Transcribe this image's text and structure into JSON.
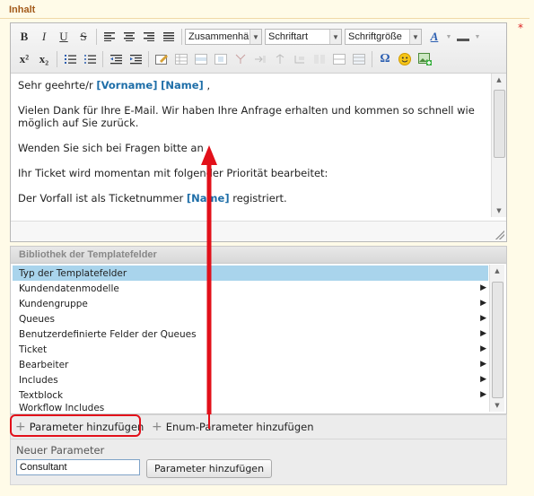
{
  "section": {
    "title": "Inhalt",
    "required_marker": "*"
  },
  "toolbar": {
    "row1": [
      {
        "icon": "bold-icon",
        "glyph": "B"
      },
      {
        "icon": "italic-icon",
        "glyph": "I"
      },
      {
        "icon": "underline-icon",
        "glyph": "U"
      },
      {
        "icon": "strikethrough-icon",
        "glyph": "S"
      },
      {
        "icon": "align-left-icon"
      },
      {
        "icon": "align-center-icon"
      },
      {
        "icon": "align-right-icon"
      },
      {
        "icon": "align-justify-icon"
      }
    ],
    "format_select": "Zusammenhäng",
    "font_select": "Schriftart",
    "size_select": "Schriftgröße",
    "text_color_glyph": "A",
    "row2": [
      {
        "icon": "superscript-icon",
        "glyph": "x²"
      },
      {
        "icon": "subscript-icon",
        "glyph": "x₂"
      },
      {
        "icon": "numbered-list-icon"
      },
      {
        "icon": "bulleted-list-icon"
      },
      {
        "icon": "outdent-icon"
      },
      {
        "icon": "indent-icon"
      },
      {
        "icon": "edit-table-icon"
      },
      {
        "icon": "insert-table-icon"
      },
      {
        "icon": "special-char-icon",
        "glyph": "Ω"
      },
      {
        "icon": "smiley-icon"
      },
      {
        "icon": "image-icon"
      }
    ]
  },
  "editor": {
    "line1_prefix": "Sehr geehrte/r ",
    "line1_ph1": "[Vorname]",
    "line1_ph2": "[Name]",
    "line1_suffix": " ,",
    "line2": "Vielen Dank für Ihre E-Mail. Wir haben Ihre Anfrage erhalten und kommen so schnell wie möglich auf Sie zurück.",
    "line3": "Wenden Sie sich bei Fragen bitte an",
    "line4": "Ihr Ticket wird momentan mit folgender Priorität bearbeitet:",
    "line5_prefix": "Der Vorfall ist als Ticketnummer ",
    "line5_ph": "[Name]",
    "line5_suffix": " registriert."
  },
  "library": {
    "header": "Bibliothek der Templatefelder",
    "items": [
      {
        "label": "Typ der Templatefelder",
        "selected": true,
        "has_children": false
      },
      {
        "label": "Kundendatenmodelle",
        "selected": false,
        "has_children": true
      },
      {
        "label": "Kundengruppe",
        "selected": false,
        "has_children": true
      },
      {
        "label": "Queues",
        "selected": false,
        "has_children": true
      },
      {
        "label": "Benutzerdefinierte Felder der Queues",
        "selected": false,
        "has_children": true
      },
      {
        "label": "Ticket",
        "selected": false,
        "has_children": true
      },
      {
        "label": "Bearbeiter",
        "selected": false,
        "has_children": true
      },
      {
        "label": "Includes",
        "selected": false,
        "has_children": true
      },
      {
        "label": "Textblock",
        "selected": false,
        "has_children": true
      },
      {
        "label": "Workflow Includes",
        "selected": false,
        "has_children": false
      }
    ]
  },
  "actions": {
    "add_parameter": "Parameter hinzufügen",
    "add_enum_parameter": "Enum-Parameter hinzufügen"
  },
  "new_parameter": {
    "label": "Neuer Parameter",
    "input_value": "Consultant",
    "submit": "Parameter hinzufügen"
  },
  "colors": {
    "accent_placeholder": "#1e6ea8",
    "selection": "#a9d4ec",
    "annotation_red": "#e2101a",
    "title": "#a35a1a"
  }
}
